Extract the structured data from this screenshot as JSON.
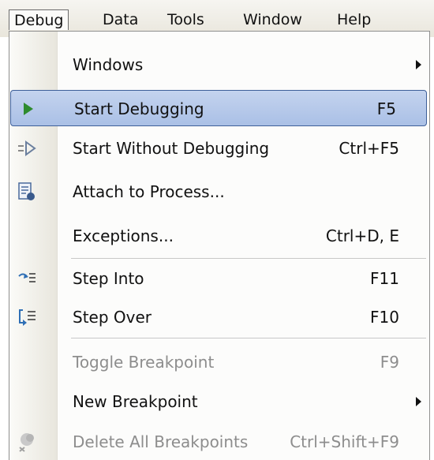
{
  "menubar": {
    "items": [
      {
        "label": "Debug"
      },
      {
        "label": "Data"
      },
      {
        "label": "Tools"
      },
      {
        "label": "Window"
      },
      {
        "label": "Help"
      }
    ]
  },
  "menu": {
    "items": [
      {
        "label": "Windows",
        "shortcut": "",
        "has_submenu": true
      },
      {
        "label": "Start Debugging",
        "shortcut": "F5",
        "highlighted": true,
        "icon": "play-icon"
      },
      {
        "label": "Start Without Debugging",
        "shortcut": "Ctrl+F5",
        "icon": "start-without-debugging-icon"
      },
      {
        "label": "Attach to Process...",
        "shortcut": "",
        "icon": "attach-process-icon"
      },
      {
        "label": "Exceptions...",
        "shortcut": "Ctrl+D, E"
      },
      {
        "label": "Step Into",
        "shortcut": "F11",
        "icon": "step-into-icon"
      },
      {
        "label": "Step Over",
        "shortcut": "F10",
        "icon": "step-over-icon"
      },
      {
        "label": "Toggle Breakpoint",
        "shortcut": "F9",
        "disabled": true
      },
      {
        "label": "New Breakpoint",
        "shortcut": "",
        "has_submenu": true
      },
      {
        "label": "Delete All Breakpoints",
        "shortcut": "Ctrl+Shift+F9",
        "disabled": true,
        "icon": "delete-breakpoints-icon"
      }
    ]
  },
  "colors": {
    "highlight_bg": "#b7c9ea",
    "highlight_border": "#3d5f99",
    "play_icon": "#2e8b2e",
    "disabled_text": "#8d8d8d"
  }
}
